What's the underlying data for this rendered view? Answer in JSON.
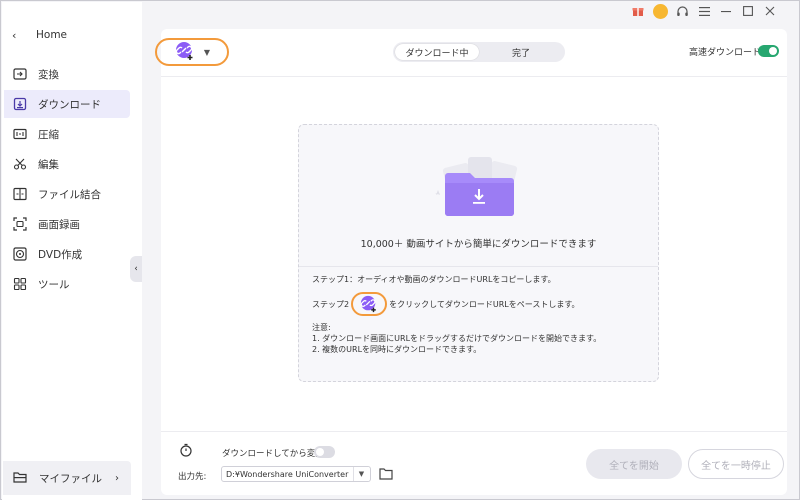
{
  "sidebar": {
    "home_label": "Home",
    "items": [
      {
        "label": "変換",
        "icon": "convert-icon"
      },
      {
        "label": "ダウンロード",
        "icon": "download-icon",
        "active": true
      },
      {
        "label": "圧縮",
        "icon": "compress-icon"
      },
      {
        "label": "編集",
        "icon": "edit-scissors-icon"
      },
      {
        "label": "ファイル結合",
        "icon": "merge-icon"
      },
      {
        "label": "画面録画",
        "icon": "screen-record-icon"
      },
      {
        "label": "DVD作成",
        "icon": "dvd-icon"
      },
      {
        "label": "ツール",
        "icon": "tools-icon"
      }
    ],
    "my_files_label": "マイファイル"
  },
  "titlebar": {
    "icons": [
      "gift-icon",
      "avatar",
      "headset-icon",
      "menu-icon",
      "minimize-icon",
      "maximize-icon",
      "close-icon"
    ]
  },
  "toolbar": {
    "tabs": [
      {
        "label": "ダウンロード中",
        "active": true
      },
      {
        "label": "完了",
        "active": false
      }
    ],
    "high_speed_label": "高速ダウンロード",
    "high_speed_on": true
  },
  "dropzone": {
    "main_text": "10,000＋ 動画サイトから簡単にダウンロードできます",
    "step1": "ステップ1：オーディオや動画のダウンロードURLをコピーします。",
    "step2_prefix": "ステップ2",
    "step2_suffix": "をクリックしてダウンロードURLをペーストします。",
    "notes_title": "注意:",
    "note1": "1. ダウンロード画面にURLをドラッグするだけでダウンロードを開始できます。",
    "note2": "2. 複数のURLを同時にダウンロードできます。"
  },
  "footer": {
    "convert_after_label": "ダウンロードしてから変換",
    "convert_after_on": false,
    "output_label": "出力先:",
    "output_path": "D:¥Wondershare UniConverter",
    "start_all_label": "全てを開始",
    "pause_all_label": "全てを一時停止"
  },
  "colors": {
    "accent": "#f39a3b",
    "brand_purple": "#8b5cf6",
    "toggle_on": "#27a770",
    "active_nav_bg": "#ecebfb"
  }
}
